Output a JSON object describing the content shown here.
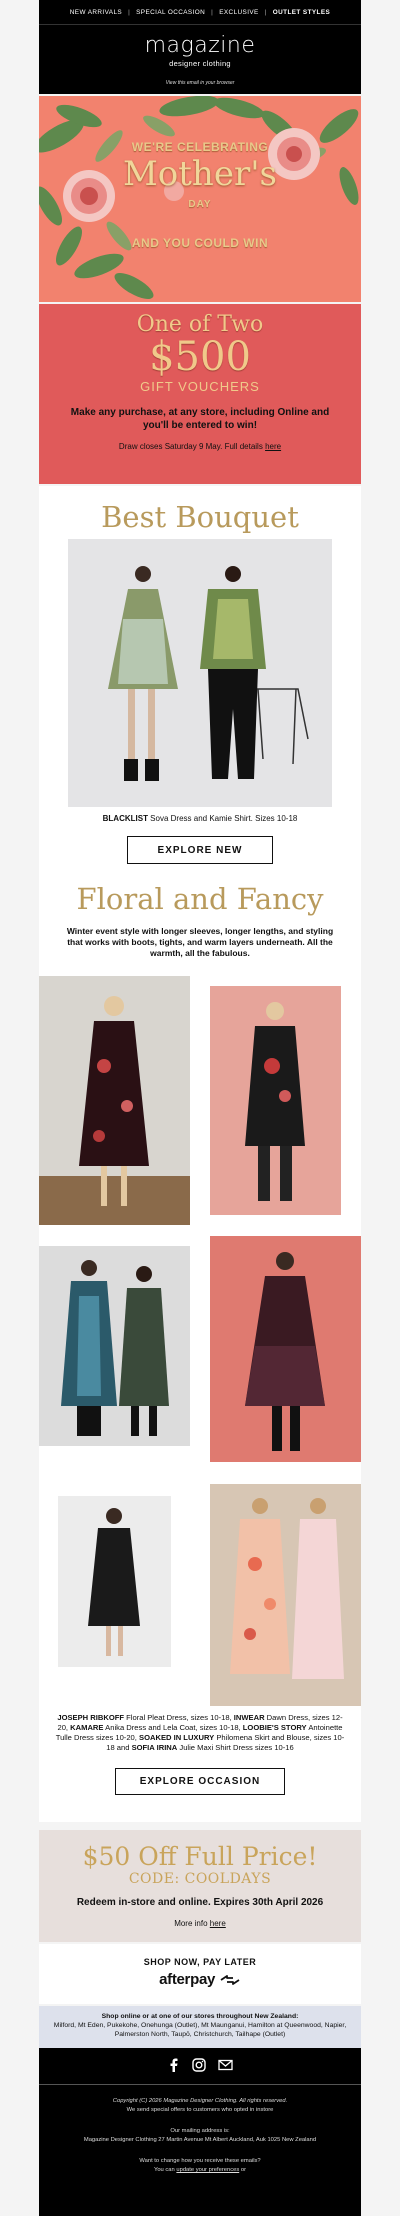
{
  "topnav": {
    "items": [
      "NEW ARRIVALS",
      "SPECIAL OCCASION",
      "EXCLUSIVE",
      "OUTLET STYLES"
    ]
  },
  "header": {
    "logo": "magazine",
    "sub": "designer clothing",
    "view_in_browser": "View this email in your browser"
  },
  "hero": {
    "line1": "WE'RE CELEBRATING",
    "line2": "Mother's",
    "line3": "DAY",
    "line4": "AND YOU COULD WIN"
  },
  "voucher": {
    "line1": "One of Two",
    "line2": "$500",
    "line3": "GIFT VOUCHERS",
    "instruction": "Make any purchase, at any store, including Online and you'll be entered to win!",
    "draw_text": "Draw closes Saturday 9 May. Full details",
    "draw_link": "here"
  },
  "best": {
    "title": "Best Bouquet",
    "caption_brand": "BLACKLIST",
    "caption_rest": " Sova Dress and Kamie Shirt. Sizes 10-18",
    "button": "EXPLORE NEW"
  },
  "floral": {
    "title": "Floral and Fancy",
    "intro": "Winter event style with longer sleeves, longer lengths, and styling that works with boots, tights, and warm layers underneath. All the warmth, all the fabulous.",
    "caption": [
      {
        "b": "JOSEPH RIBKOFF",
        "t": " Floral Pleat Dress, sizes 10-18, "
      },
      {
        "b": "INWEAR",
        "t": " Dawn Dress, sizes 12-20, "
      },
      {
        "b": "KAMARE",
        "t": " Anika Dress and Lela Coat, sizes 10-18, "
      },
      {
        "b": "LOOBIE'S STORY",
        "t": " Antoinette Tulle Dress sizes 10-20, "
      },
      {
        "b": "SOAKED IN LUXURY",
        "t": " Philomena Skirt and Blouse, sizes 10-18 and "
      },
      {
        "b": "SOFIA IRINA",
        "t": " Julie Maxi Shirt Dress sizes 10-16"
      }
    ],
    "button": "EXPLORE OCCASION"
  },
  "promo": {
    "line1": "$50 Off Full Price!",
    "line2": "CODE: COOLDAYS",
    "line3": "Redeem in-store and online. Expires 30th April 2026",
    "more": "More info",
    "more_link": "here"
  },
  "afterpay": {
    "label": "SHOP NOW, PAY LATER",
    "brand": "afterpay"
  },
  "stores": {
    "heading": "Shop online or at one of our stores throughout New Zealand:",
    "list": "Milford, Mt Eden, Pukekohe, Onehunga (Outlet), Mt Maunganui, Hamilton at Queenwood, Napier, Palmerston North, Taupō, Christchurch, Tailhape (Outlet)"
  },
  "footer": {
    "copyright": "Copyright (C) 2026 Magazine Designer Clothing. All rights reserved.",
    "sent": "We send special offers to customers who opted in instore",
    "mailing_label": "Our mailing address is:",
    "address": "Magazine Designer Clothing 27 Martin Avenue Mt Albert Auckland, Auk 1025 New Zealand",
    "change": "Want to change how you receive these emails?",
    "update_prefix": "You can",
    "update_link": "update your preferences",
    "update_suffix": "or"
  },
  "colors": {
    "hero_bg": "#f2826e",
    "voucher_bg": "#e05a5a",
    "gold": "#b89a5c",
    "promo_bg": "#e7dfdc",
    "stores_bg": "#dde1ec"
  }
}
